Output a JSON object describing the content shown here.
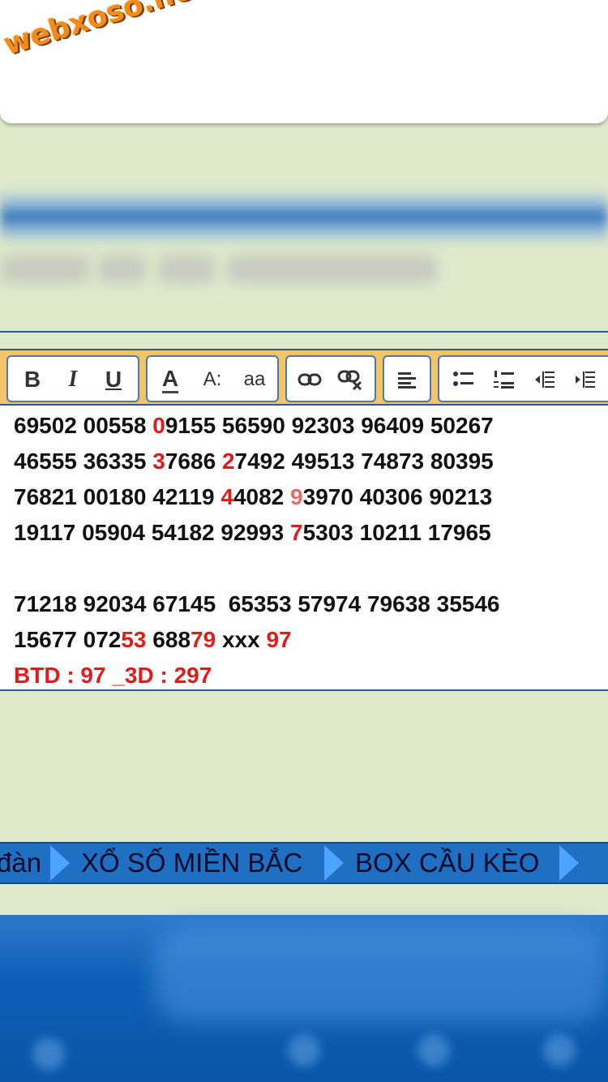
{
  "logo": {
    "text": "webxoso.net"
  },
  "toolbar": {
    "buttons": [
      {
        "name": "bold",
        "glyph": "B"
      },
      {
        "name": "italic",
        "glyph": "I"
      },
      {
        "name": "underline",
        "glyph": "U"
      },
      {
        "name": "font-color",
        "glyph": "A"
      },
      {
        "name": "font-size",
        "glyph": "A:"
      },
      {
        "name": "font-family",
        "glyph": "aa"
      }
    ]
  },
  "editor": {
    "line1": {
      "a": "69502 00558 ",
      "b": "0",
      "c": "9155 56590 92303 96409 50267"
    },
    "line2": {
      "a": "46555 36335 ",
      "b": "3",
      "c": "7686 ",
      "d": "2",
      "e": "7492 49513 74873 80395"
    },
    "line3": {
      "a": "76821 00180 42119 ",
      "b": "4",
      "c": "4082 ",
      "d": "9",
      "e": "3970 40306 90213"
    },
    "line4": {
      "a": "19117 05904 54182 92993 ",
      "b": "7",
      "c": "5303 10211 17965"
    },
    "line5": {
      "a": "71218 92034 67145  65353 57974 79638 35546"
    },
    "line6": {
      "a": "15677 072",
      "b": "53",
      "c": " 688",
      "d": "79",
      "e": " xxx ",
      "f": "97"
    },
    "line7": {
      "a": "BTD : 97 _3D : 297"
    }
  },
  "nav": {
    "items": [
      {
        "label": "đàn"
      },
      {
        "label": "XỔ SỐ MIỀN BẮC"
      },
      {
        "label": "BOX CẦU KÈO"
      }
    ]
  },
  "colors": {
    "page_bg": "#dfeacb",
    "toolbar_bg": "#f1c46a",
    "highlight_red": "#e01b1b",
    "nav_bg": "#1f6fc2",
    "nav_arrow": "#4da3ff"
  }
}
